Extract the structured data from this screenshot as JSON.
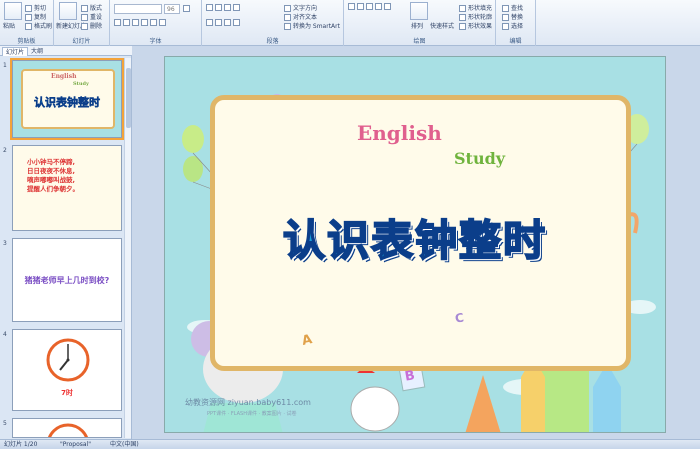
{
  "ribbon": {
    "clipboard": {
      "paste": "粘贴",
      "cut": "剪切",
      "copy": "复制",
      "format_painter": "格式刷",
      "label": "剪贴板"
    },
    "slides": {
      "new_slide": "新建幻灯片",
      "layout": "版式",
      "reset": "重设",
      "delete": "删除",
      "label": "幻灯片"
    },
    "font": {
      "size": "96",
      "label": "字体"
    },
    "paragraph": {
      "text_direction": "文字方向",
      "align_text": "对齐文本",
      "smartart": "转换为 SmartArt",
      "label": "段落"
    },
    "drawing": {
      "arrange": "排列",
      "quick_styles": "快速样式",
      "shape_fill": "形状填充",
      "shape_outline": "形状轮廓",
      "shape_effects": "形状效果",
      "label": "绘图"
    },
    "editing": {
      "find": "查找",
      "replace": "替换",
      "select": "选择",
      "label": "编辑"
    }
  },
  "panel": {
    "tab_slides": "幻灯片",
    "tab_outline": "大纲",
    "thumbs": [
      {
        "num": "1",
        "title": "认识表钟整时",
        "english": "English",
        "study": "Study"
      },
      {
        "num": "2",
        "lines": [
          "小小钟马不停蹄,",
          "日日夜夜不休息,",
          "嘀声嘟嘟叫战鼓,",
          "提醒人们争朝夕。"
        ]
      },
      {
        "num": "3",
        "text": "猪猪老师早上几时到校?"
      },
      {
        "num": "4",
        "caption": "7时"
      },
      {
        "num": "5"
      }
    ]
  },
  "slide": {
    "title": "认识表钟整时",
    "english": "English",
    "study": "Study",
    "letters": [
      "A",
      "B",
      "C"
    ],
    "watermark": "幼教资源网 ziyuan.baby611.com",
    "watermark_sub": "PPT课件 · FLASH课件 · 教案图片 · 试卷"
  },
  "status": {
    "slide_pos": "幻灯片 1/20",
    "theme": "\"Proposal\"",
    "language": "中文(中国)"
  },
  "colors": {
    "accent": "#f3a33a",
    "title_fill": "#1a9ed8",
    "title_stroke": "#0b3e8a",
    "slide_bg": "#a8e0e4",
    "frame_border": "#e0b668"
  }
}
